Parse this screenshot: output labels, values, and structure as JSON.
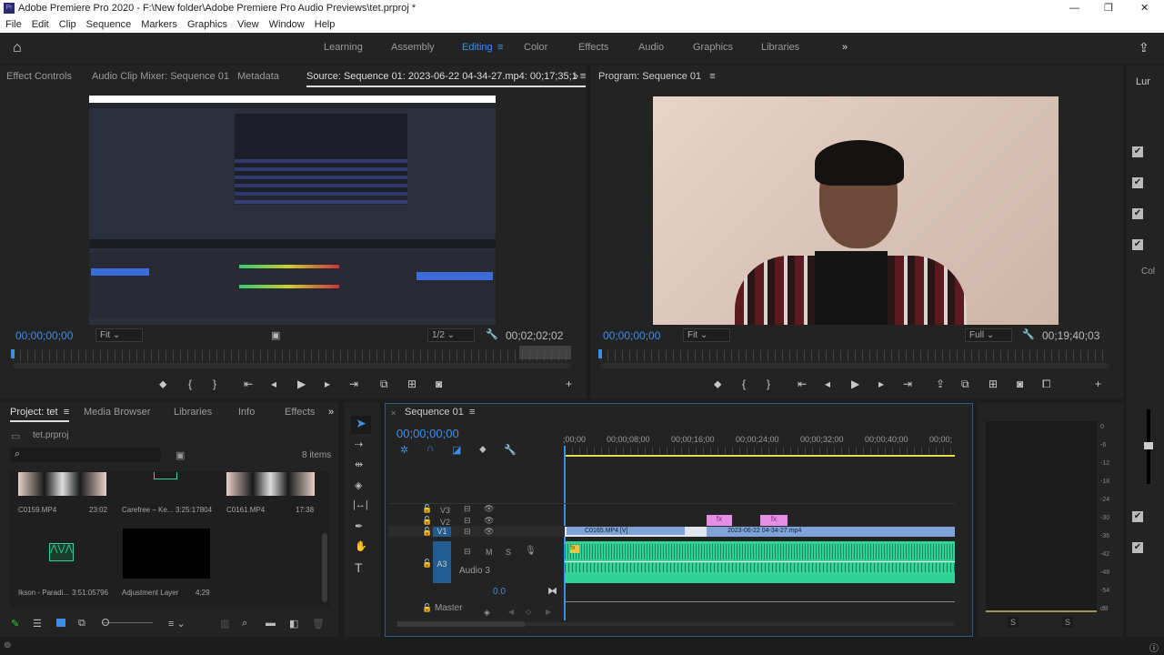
{
  "window": {
    "title": "Adobe Premiere Pro 2020 - F:\\New folder\\Adobe Premiere Pro Audio Previews\\tet.prproj *",
    "app_badge": "Pr",
    "minimize": "—",
    "maximize": "❐",
    "close": "✕"
  },
  "menu": [
    "File",
    "Edit",
    "Clip",
    "Sequence",
    "Markers",
    "Graphics",
    "View",
    "Window",
    "Help"
  ],
  "workspaces": {
    "items": [
      "Learning",
      "Assembly",
      "Editing",
      "Color",
      "Effects",
      "Audio",
      "Graphics",
      "Libraries"
    ],
    "active": "Editing",
    "more": "»"
  },
  "source_panel": {
    "tabs": [
      "Effect Controls",
      "Audio Clip Mixer: Sequence 01",
      "Metadata",
      "Source: Sequence 01: 2023-06-22 04-34-27.mp4: 00;17;35;1"
    ],
    "more": "»",
    "timecode_in": "00;00;00;00",
    "zoom": "Fit",
    "resolution": "1/2",
    "duration": "00;02;02;02"
  },
  "program_panel": {
    "title": "Program: Sequence 01",
    "timecode_in": "00;00;00;00",
    "zoom": "Fit",
    "resolution": "Full",
    "duration": "00;19;40;03"
  },
  "lumetri": {
    "tab": "Lur",
    "col": "Col"
  },
  "project_panel": {
    "tabs": [
      "Project: tet",
      "Media Browser",
      "Libraries",
      "Info",
      "Effects"
    ],
    "more": "»",
    "project_file": "tet.prproj",
    "search_placeholder": "",
    "item_count": "8 items",
    "items": [
      {
        "name": "C0159.MP4",
        "duration": "23:02",
        "kind": "video"
      },
      {
        "name": "Carefree – Ke...",
        "duration": "3:25:17804",
        "kind": "audio"
      },
      {
        "name": "C0161.MP4",
        "duration": "17:38",
        "kind": "video"
      },
      {
        "name": "Ikson - Paradi...",
        "duration": "3:51:05796",
        "kind": "audio"
      },
      {
        "name": "Adjustment Layer",
        "duration": "4;29",
        "kind": "black"
      }
    ]
  },
  "timeline": {
    "title": "Sequence 01",
    "timecode": "00;00;00;00",
    "ruler": [
      ";00;00",
      "00;00;08;00",
      "00;00;16;00",
      "00;00;24;00",
      "00;00;32;00",
      "00;00;40;00",
      "00;00;"
    ],
    "tracks": {
      "v3": "V3",
      "v2": "V2",
      "v1": "V1",
      "a3": "A3",
      "a3_name": "Audio 3",
      "m": "M",
      "s": "S",
      "volume": "0.0",
      "master": "Master"
    },
    "clips": {
      "v1a": "C0165.MP4 [V]",
      "v1b": "2023-06-22 04-34-27.mp4",
      "fx": "fx"
    }
  },
  "meters": {
    "scale": [
      "0",
      "-6",
      "-12",
      "-18",
      "-24",
      "-30",
      "-36",
      "-42",
      "-48",
      "-54",
      "dB"
    ],
    "solo": "S"
  },
  "colors": {
    "accent": "#3d8ee8",
    "audio_clip": "#2fd397",
    "video_clip": "#7fa3d8",
    "fx_clip": "#e48ee6"
  }
}
